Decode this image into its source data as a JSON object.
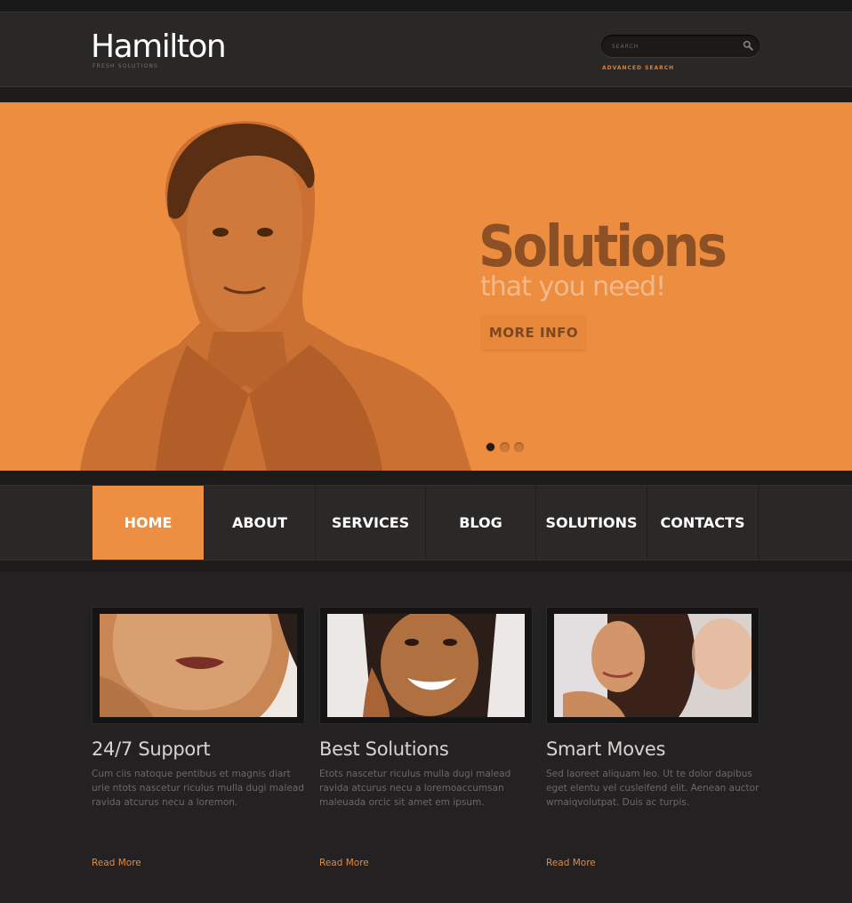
{
  "header": {
    "logo": "Hamilton",
    "tagline": "FRESH SOLUTIONS",
    "search_placeholder": "SEARCH",
    "advanced_search": "ADVANCED SEARCH"
  },
  "hero": {
    "title": "Solutions",
    "subtitle": "that you need!",
    "button": "MORE INFO",
    "slides_total": 3,
    "active_slide": 1
  },
  "nav": {
    "items": [
      {
        "label": "HOME",
        "active": true
      },
      {
        "label": "ABOUT",
        "active": false
      },
      {
        "label": "SERVICES",
        "active": false
      },
      {
        "label": "BLOG",
        "active": false
      },
      {
        "label": "SOLUTIONS",
        "active": false
      },
      {
        "label": "CONTACTS",
        "active": false
      }
    ]
  },
  "features": [
    {
      "title": "24/7 Support",
      "text": "Cum ciis natoque pentibus et magnis diart urie ntots nascetur riculus mulla dugi malead ravida atcurus necu a loremon.",
      "link": "Read More"
    },
    {
      "title": "Best Solutions",
      "text": "Etots nascetur riculus mulla dugi malead ravida atcurus necu a loremoaccumsan maleuada orcic sit amet em ipsum.",
      "link": "Read More"
    },
    {
      "title": "Smart Moves",
      "text": "Sed laoreet aliquam leo. Ut te dolor dapibus eget elentu vel cusleifend elit. Aenean auctor wrnaiqvolutpat. Duis ac turpis.",
      "link": "Read More"
    }
  ],
  "colors": {
    "accent": "#ED8F42",
    "dark_bg": "#232121",
    "header_bg": "#2A2827"
  }
}
